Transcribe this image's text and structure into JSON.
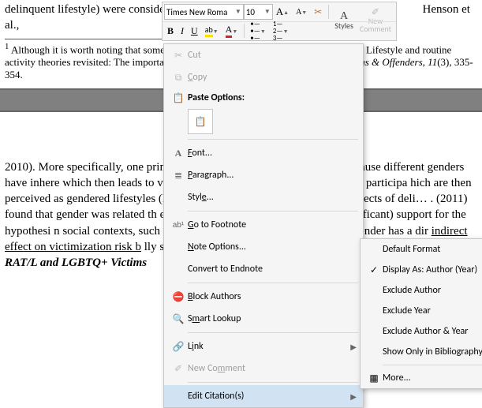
{
  "document": {
    "top_line": "delinquent lifestyle) were considered",
    "top_line_cont": " Henson et al.,",
    "footnote_marker": "1",
    "footnote_text": "Although it is worth noting that some theor                                                                                                      bly, Pratt, T. C., & Turanovic, J. J. (2016). Lifestyle and routine activity theories revisited: The importance of \"risk\" to the study of victimization. ",
    "footnote_journal": "Victims & Offenders, 11",
    "footnote_pages": "(3), 335-354.",
    "body": "2010). More specifically, one prima…                                                        ered victimization patterns exist because different genders have inhere                                          which then leads to victimization), or because different genders participa                                             hich are then perceived as gendered lifestyles (Henson et al., 20                                                          gender moderated the effects of deli…                                                        . (2011) found that gender was related                                                                                  th extracurricular routine activities. Sim                                                        significant) support for the hypothesi                                                                                      n social contexts, such as going to bars                                                                                          es demonstrate not that gender has a dir                                                        ",
    "body_ul": "indirect effect on victimization risk b",
    "body_tail": "                                                                                                lly suggested by Hindelang and his colle",
    "body_italic": "RAT/L and LGBTQ+ Victims"
  },
  "mini_toolbar": {
    "font_name": "Times New Roma",
    "font_size": "10",
    "grow": "A",
    "shrink": "A",
    "format_painter": "✂",
    "bold": "B",
    "italic": "I",
    "underline": "U",
    "highlight": "ab",
    "font_color": "A",
    "bullets": "•",
    "numbering": "1",
    "styles": "Styles",
    "new_comment_l1": "New",
    "new_comment_l2": "Comment"
  },
  "context_menu": {
    "cut": "Cut",
    "copy": "Copy",
    "paste_header": "Paste Options:",
    "font": "Font...",
    "paragraph": "Paragraph...",
    "style": "Style...",
    "go_to_footnote": "Go to Footnote",
    "note_options": "Note Options...",
    "convert_to_endnote": "Convert to Endnote",
    "block_authors": "Block Authors",
    "smart_lookup": "Smart Lookup",
    "link": "Link",
    "new_comment": "New Comment",
    "edit_citations": "Edit Citation(s)"
  },
  "submenu": {
    "default_format": "Default Format",
    "display_as": "Display As: Author (Year)",
    "exclude_author": "Exclude Author",
    "exclude_year": "Exclude Year",
    "exclude_author_year": "Exclude Author & Year",
    "show_only_bib": "Show Only in Bibliography",
    "more": "More..."
  },
  "icons": {
    "cut": "✂",
    "copy": "⧉",
    "paste": "📋",
    "font_a": "A",
    "paragraph": "¶",
    "go_to": "ab¹",
    "block": "⛔",
    "smart": "🔍",
    "link": "🔗",
    "comment": "✐",
    "more": "▦",
    "styles_a": "A",
    "check": "✓",
    "arrow": "▶"
  }
}
